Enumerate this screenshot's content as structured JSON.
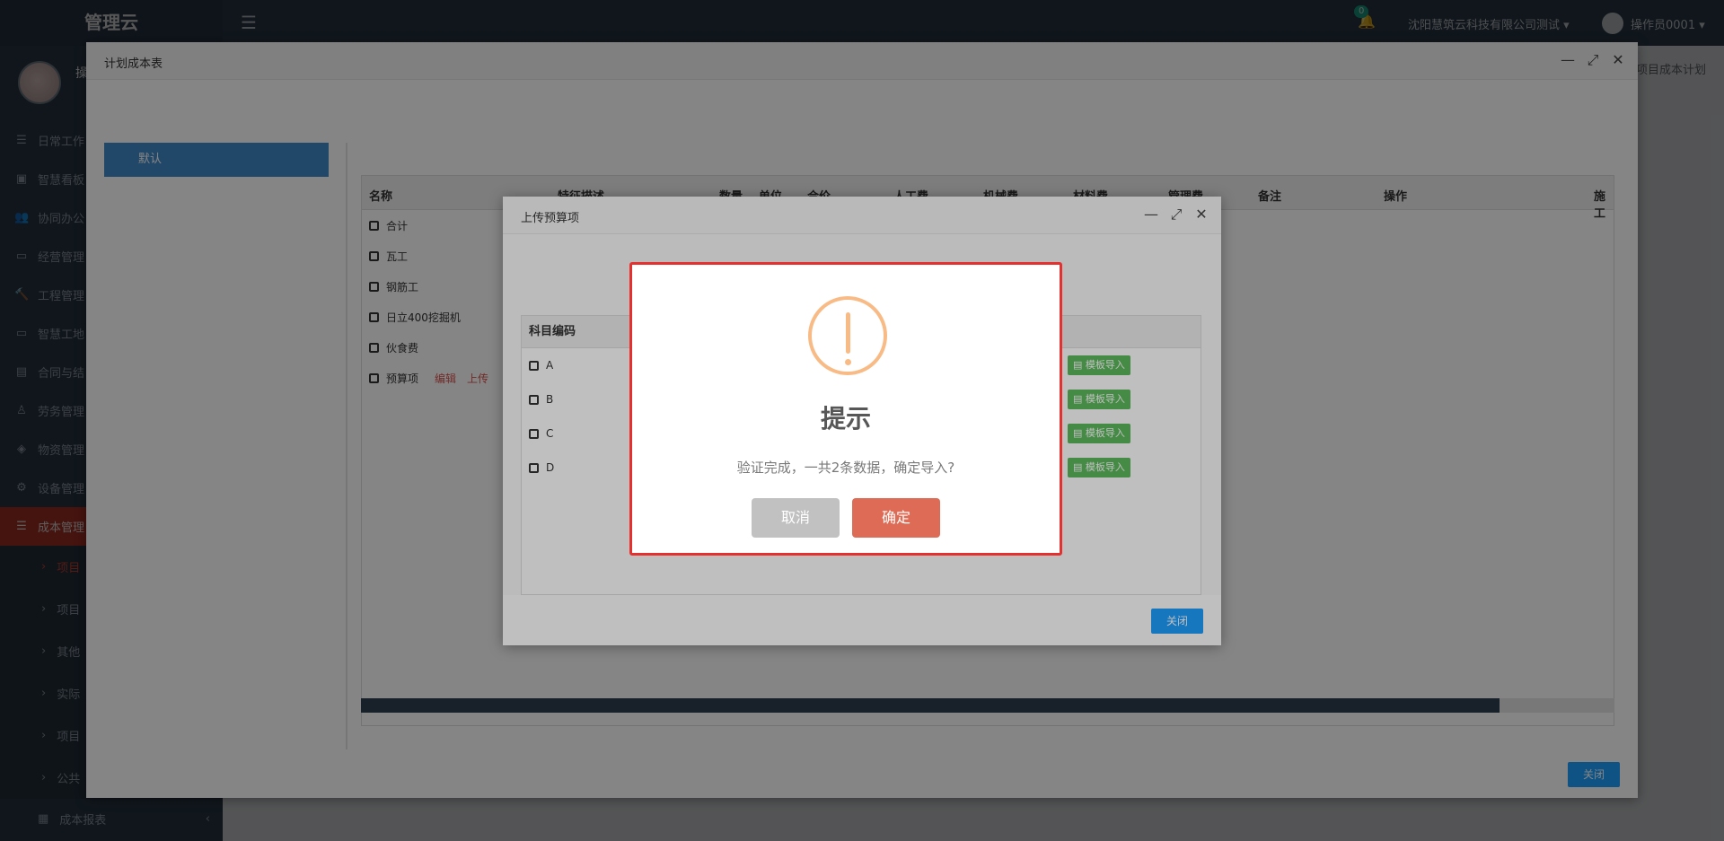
{
  "app": {
    "brand": "管理云",
    "bell_count": "0",
    "company": "沈阳慧筑云科技有限公司测试 ▾",
    "user": "操作员0001 ▾",
    "breadcrumb": "项目成本计划",
    "reset_label": "重置"
  },
  "sidebar": {
    "profile_name": "操",
    "items": [
      {
        "label": "日常工作",
        "icon": "list-icon"
      },
      {
        "label": "智慧看板",
        "icon": "dashboard-icon"
      },
      {
        "label": "协同办公",
        "icon": "users-icon"
      },
      {
        "label": "经营管理",
        "icon": "desktop-icon"
      },
      {
        "label": "工程管理",
        "icon": "gavel-icon"
      },
      {
        "label": "智慧工地",
        "icon": "desktop-icon"
      },
      {
        "label": "合同与结",
        "icon": "file-icon"
      },
      {
        "label": "劳务管理",
        "icon": "worker-icon"
      },
      {
        "label": "物资管理",
        "icon": "cube-icon"
      },
      {
        "label": "设备管理",
        "icon": "cubes-icon"
      },
      {
        "label": "成本管理",
        "icon": "list-icon"
      }
    ],
    "subitems": [
      "项目",
      "项目",
      "其他",
      "实际",
      "项目",
      "公共"
    ],
    "bottom_label": "成本报表"
  },
  "plan_window": {
    "title": "计划成本表",
    "tree_node": "默认",
    "columns": [
      "名称",
      "特征描述",
      "数量",
      "单位",
      "合价",
      "人工费",
      "机械费",
      "材料费",
      "管理费",
      "备注",
      "操作",
      "施工"
    ],
    "rows": [
      {
        "name": "合计"
      },
      {
        "name": "瓦工"
      },
      {
        "name": "钢筋工"
      },
      {
        "name": "日立400挖掘机"
      },
      {
        "name": "伙食费"
      },
      {
        "name": "预算项",
        "edit": "编辑",
        "upload": "上传"
      }
    ],
    "close_label": "关闭"
  },
  "upload_window": {
    "title": "上传预算项",
    "column": "科目编码",
    "rows": [
      "A",
      "B",
      "C",
      "D"
    ],
    "template_btn": "模板导入",
    "close_label": "关闭"
  },
  "alert": {
    "title": "提示",
    "message": "验证完成，一共2条数据，确定导入?",
    "cancel": "取消",
    "confirm": "确定",
    "icon_color": "#f8bb86",
    "confirm_color": "#dd6b55"
  }
}
